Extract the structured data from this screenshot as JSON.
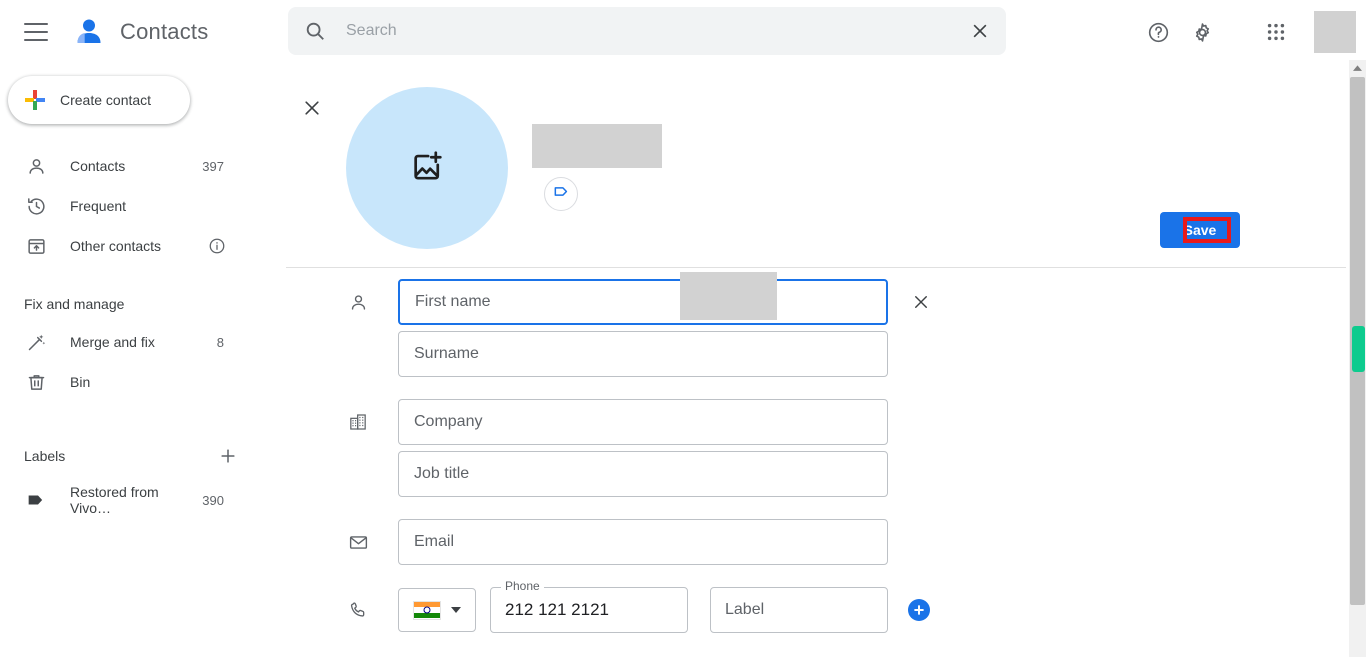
{
  "header": {
    "menu_icon": "hamburger-menu-icon",
    "logo_icon": "google-contacts-logo",
    "title": "Contacts",
    "search": {
      "icon": "search-icon",
      "placeholder": "Search",
      "value": "",
      "clear_icon": "close-icon"
    },
    "help_icon": "help-icon",
    "settings_icon": "gear-icon",
    "apps_icon": "apps-grid-icon",
    "avatar": "redacted-avatar"
  },
  "sidebar": {
    "create": {
      "label": "Create contact",
      "icon": "google-plus-icon"
    },
    "items": [
      {
        "label": "Contacts",
        "count": "397",
        "icon": "person-icon"
      },
      {
        "label": "Frequent",
        "count": "",
        "icon": "history-clock-icon"
      },
      {
        "label": "Other contacts",
        "count": "",
        "icon": "archive-box-icon",
        "info_icon": "info-icon"
      }
    ],
    "fix_section_title": "Fix and manage",
    "fix_items": [
      {
        "label": "Merge and fix",
        "count": "8",
        "icon": "magic-wand-icon"
      },
      {
        "label": "Bin",
        "count": "",
        "icon": "trash-bin-icon"
      }
    ],
    "labels_title": "Labels",
    "labels_add_icon": "plus-icon",
    "labels": [
      {
        "label": "Restored from Vivo…",
        "count": "390",
        "icon": "label-tag-icon"
      }
    ]
  },
  "main": {
    "close_icon": "close-icon",
    "photo": {
      "icon": "add-photo-icon",
      "bg_color": "#c8e6fb"
    },
    "name_display_redacted": true,
    "tag_button_icon": "label-tag-icon",
    "save_label": "Save",
    "save_color": "#1a73e8",
    "highlight_color": "#e8191b",
    "fields": [
      {
        "name": "first-name",
        "icon": "person-icon",
        "placeholder": "First name",
        "value": "",
        "focused": true,
        "redacted": true,
        "remove_icon": "close-icon"
      },
      {
        "name": "surname",
        "icon": "",
        "placeholder": "Surname",
        "value": ""
      },
      {
        "name": "company",
        "icon": "building-icon",
        "placeholder": "Company",
        "value": ""
      },
      {
        "name": "job-title",
        "icon": "",
        "placeholder": "Job title",
        "value": ""
      },
      {
        "name": "email",
        "icon": "envelope-icon",
        "placeholder": "Email",
        "value": ""
      }
    ],
    "phone_row": {
      "icon": "phone-icon",
      "country_flag": "india-flag",
      "country_caret_icon": "chevron-down-icon",
      "legend": "Phone",
      "value": "212 121 2121",
      "label_placeholder": "Label",
      "label_value": "",
      "add_icon": "plus-circle-icon"
    }
  },
  "scrollbar": {
    "up_icon": "arrow-up-icon",
    "marker_color": "#0ecb8e"
  }
}
